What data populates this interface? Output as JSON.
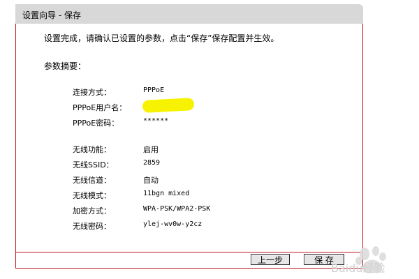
{
  "header": {
    "title": "设置向导 - 保存"
  },
  "intro_text": "设置完成，请确认已设置的参数，点击“保存”保存配置并生效。",
  "summary_title": "参数摘要：",
  "summary": [
    {
      "label": "连接方式：",
      "value": "PPPoE"
    },
    {
      "label": "PPPoE用户名：",
      "value": ""
    },
    {
      "label": "PPPoE密码：",
      "value": "******"
    },
    {
      "label": "无线功能：",
      "value": "启用"
    },
    {
      "label": "无线SSID：",
      "value": "2859"
    },
    {
      "label": "无线信道：",
      "value": "自动"
    },
    {
      "label": "无线模式：",
      "value": "11bgn mixed"
    },
    {
      "label": "加密方式：",
      "value": "WPA-PSK/WPA2-PSK"
    },
    {
      "label": "无线密码：",
      "value": "ylej-wv0w-y2cz"
    }
  ],
  "buttons": {
    "prev": "上一步",
    "save": "保 存"
  },
  "watermark": {
    "text": "Baidu经验"
  },
  "colors": {
    "panel_border": "#c0191b",
    "title_bar": "#d8d8d8",
    "redaction": "#f7f200"
  }
}
